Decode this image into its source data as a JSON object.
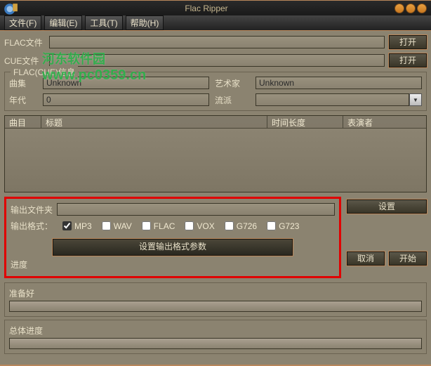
{
  "window": {
    "title": "Flac Ripper"
  },
  "menu": {
    "file": "文件(F)",
    "edit": "编辑(E)",
    "tools": "工具(T)",
    "help": "帮助(H)"
  },
  "files": {
    "flac_label": "FLAC文件",
    "cue_label": "CUE文件",
    "flac_value": "",
    "cue_value": "",
    "open_btn": "打开"
  },
  "info": {
    "legend": "FLAC(CUE)信息",
    "album_label": "曲集",
    "album_value": "Unknown",
    "artist_label": "艺术家",
    "artist_value": "Unknown",
    "year_label": "年代",
    "year_value": "0",
    "genre_label": "流派",
    "genre_value": ""
  },
  "table": {
    "col_track": "曲目",
    "col_title": "标题",
    "col_duration": "时间长度",
    "col_performer": "表演者"
  },
  "output": {
    "folder_label": "输出文件夹",
    "folder_value": "",
    "set_btn": "设置",
    "format_label": "输出格式：",
    "fmt_mp3": "MP3",
    "fmt_wav": "WAV",
    "fmt_flac": "FLAC",
    "fmt_vox": "VOX",
    "fmt_g726": "G726",
    "fmt_g723": "G723",
    "params_btn": "设置输出格式参数",
    "cancel_btn": "取消",
    "start_btn": "开始",
    "progress_label": "进度"
  },
  "progress": {
    "prepare_label": "准备好",
    "total_label": "总体进度"
  },
  "watermark": {
    "url": "www.pc0359.cn",
    "site": "河东软件园"
  }
}
